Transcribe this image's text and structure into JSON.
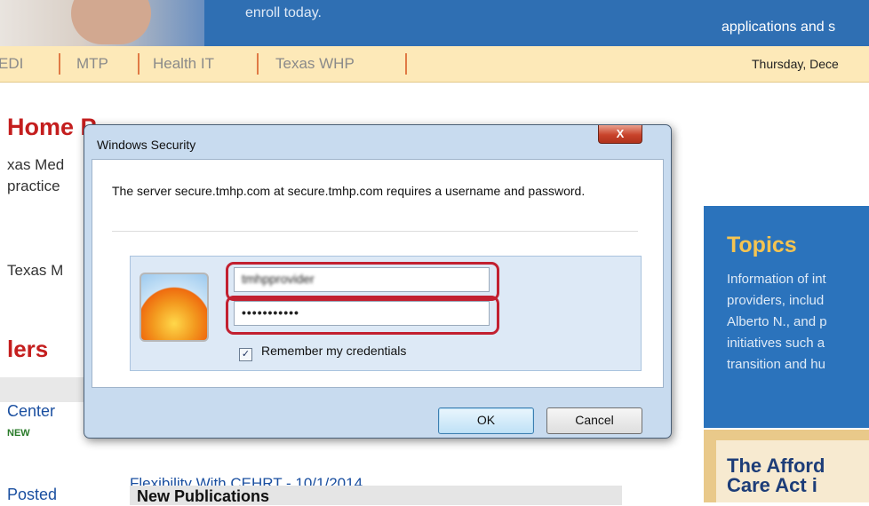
{
  "banner": {
    "text_left": "enroll today.",
    "text_right": "applications and s"
  },
  "nav": {
    "items": [
      "EDI",
      "MTP",
      "Health IT",
      "Texas WHP"
    ],
    "date": "Thursday, Dece"
  },
  "page": {
    "home_title": "Home P",
    "intro_line1": "xas Med",
    "intro_line2": "practice",
    "intro_line3": "Texas M",
    "section_title": "lers",
    "center_link": "Center",
    "new_badge": "NEW",
    "posted_link": "Posted",
    "flexibility_link": "Flexibility With CEHRT - 10/1/2014",
    "new_publications": "New Publications"
  },
  "topics": {
    "title": "Topics",
    "lines": [
      "Information of int",
      "providers, includ",
      "Alberto N., and p",
      "initiatives such a",
      "transition and hu"
    ]
  },
  "afford": {
    "line1": "The Afford",
    "line2": "Care Act i"
  },
  "dialog": {
    "title": "Windows Security",
    "close_label": "X",
    "message": "The server secure.tmhp.com at secure.tmhp.com requires a username and password.",
    "username_value": "tmhpprovider",
    "password_value": "•••••••••••",
    "remember_label": "Remember my credentials",
    "remember_checked": true,
    "ok_label": "OK",
    "cancel_label": "Cancel"
  },
  "colors": {
    "banner_blue": "#2f6fb3",
    "nav_bg": "#fde9b8",
    "title_red": "#c41e1e",
    "highlight_red": "#c22030",
    "topics_bg": "#2b73bc",
    "topics_title": "#f5c451"
  }
}
